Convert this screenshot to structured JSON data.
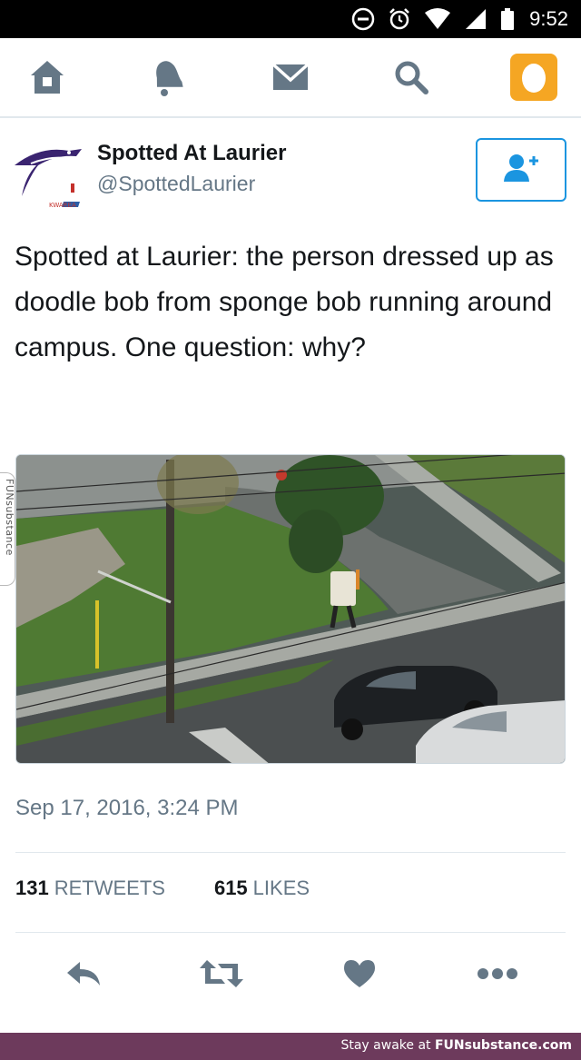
{
  "status_bar": {
    "time": "9:52",
    "icons": [
      "do-not-disturb-icon",
      "alarm-icon",
      "wifi-icon",
      "cell-signal-icon",
      "battery-icon"
    ]
  },
  "nav": {
    "items": [
      "home-icon",
      "notifications-icon",
      "messages-icon",
      "search-icon",
      "profile-icon"
    ],
    "accent": "#1b95e0",
    "icon_color": "#657786",
    "profile_color": "#f5a623"
  },
  "author": {
    "display_name": "Spotted At Laurier",
    "handle": "@SpottedLaurier",
    "avatar_text": "KWAREA"
  },
  "tweet": {
    "text": "Spotted at Laurier: the person dressed up as doodle bob from sponge bob running around campus. One question: why?",
    "timestamp": "Sep 17, 2016, 3:24 PM"
  },
  "stats": {
    "retweets_count": "131",
    "retweets_label": "RETWEETS",
    "likes_count": "615",
    "likes_label": "LIKES"
  },
  "actions": [
    "reply-icon",
    "retweet-icon",
    "like-icon",
    "more-icon"
  ],
  "watermark": {
    "side_tab": "FUNsubstance",
    "footer_prefix": "Stay awake at ",
    "footer_brand": "FUNsubstance.com"
  }
}
